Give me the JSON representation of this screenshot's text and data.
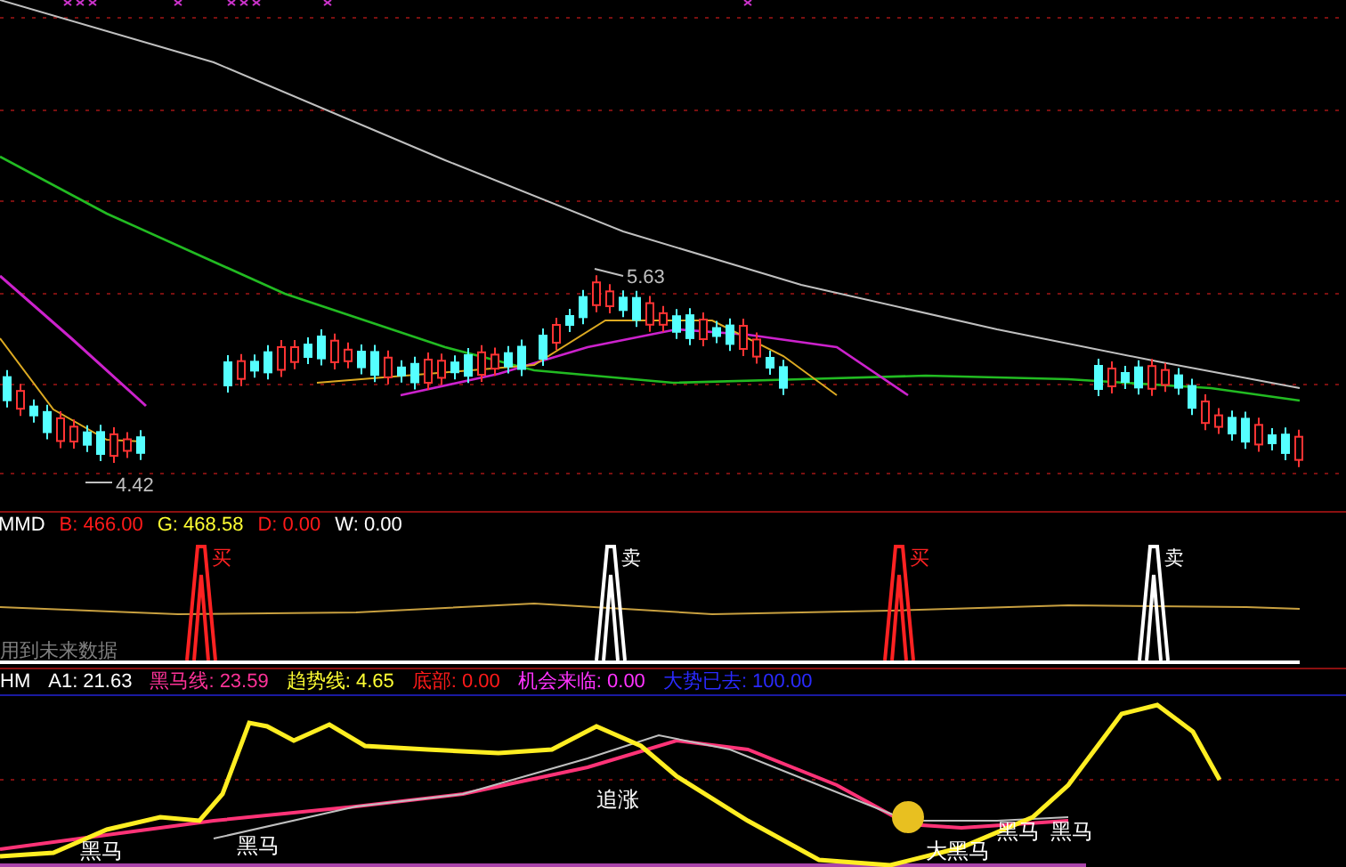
{
  "main_chart": {
    "high_label": "5.63",
    "low_label": "4.42"
  },
  "mmd_panel": {
    "legend": [
      {
        "label": "MMD",
        "color": "#ffffff"
      },
      {
        "label": "B: 466.00",
        "color": "#ff1a1a"
      },
      {
        "label": "G: 468.58",
        "color": "#ffff33"
      },
      {
        "label": "D: 0.00",
        "color": "#ff1a1a"
      },
      {
        "label": "W: 0.00",
        "color": "#ffffff"
      }
    ],
    "signals": [
      {
        "kind": "buy",
        "text": "买"
      },
      {
        "kind": "sell",
        "text": "卖"
      },
      {
        "kind": "buy",
        "text": "买"
      },
      {
        "kind": "sell",
        "text": "卖"
      }
    ],
    "note": "用到未来数据"
  },
  "hm_panel": {
    "legend": [
      {
        "label": "HM",
        "color": "#ffffff"
      },
      {
        "label": "A1: 21.63",
        "color": "#ffffff"
      },
      {
        "label": "黑马线: 23.59",
        "color": "#ff3399"
      },
      {
        "label": "趋势线: 4.65",
        "color": "#ffff33"
      },
      {
        "label": "底部: 0.00",
        "color": "#ff1a1a"
      },
      {
        "label": "机会来临: 0.00",
        "color": "#ff33ff"
      },
      {
        "label": "大势已去: 100.00",
        "color": "#2a2aff"
      }
    ],
    "labels": [
      {
        "text": "黑马"
      },
      {
        "text": "黑马"
      },
      {
        "text": "追涨"
      },
      {
        "text": "大黑马"
      },
      {
        "text": "黑马"
      },
      {
        "text": "黑马"
      }
    ]
  }
}
